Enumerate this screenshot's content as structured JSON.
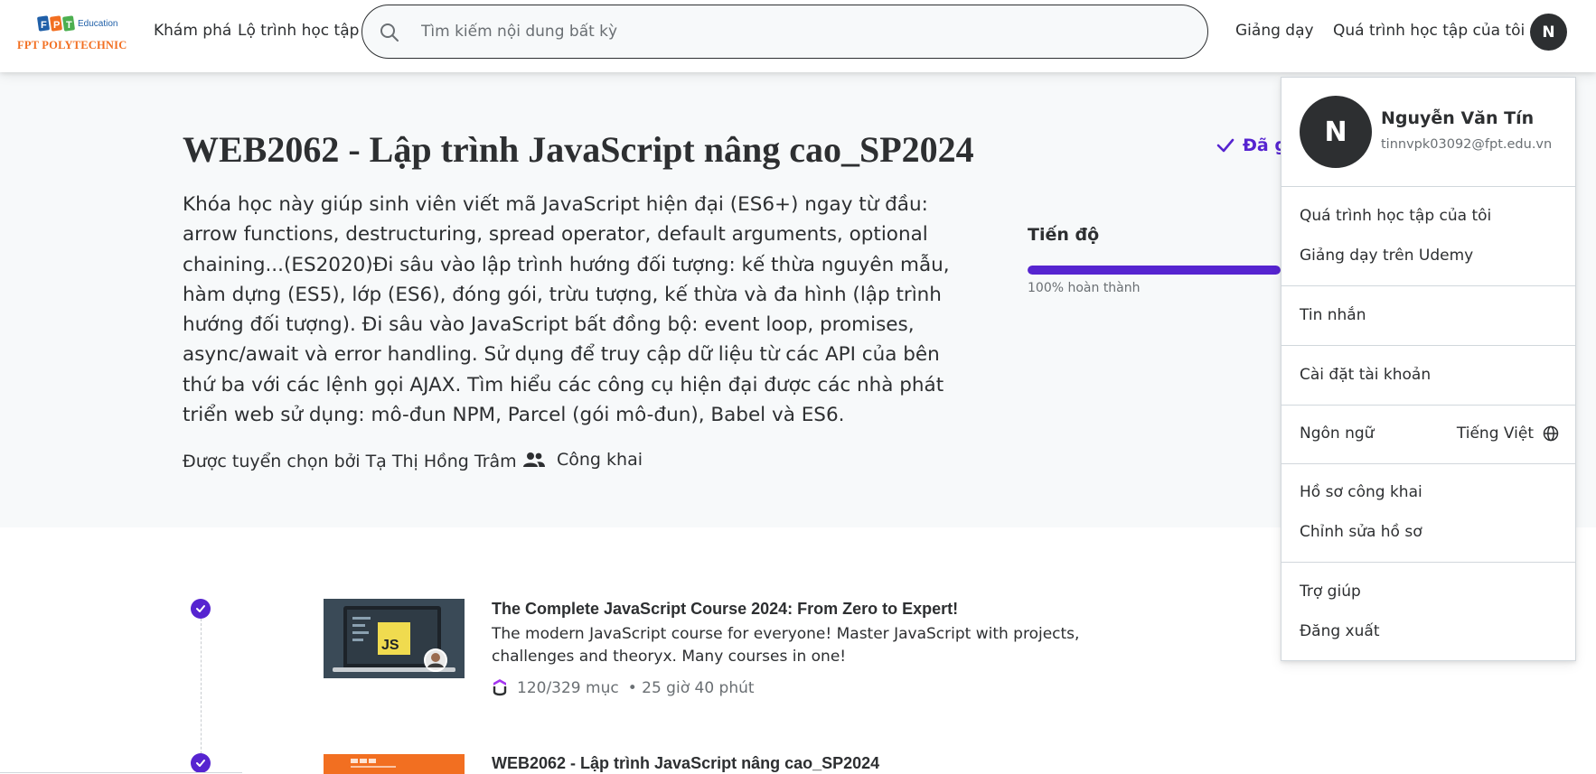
{
  "header": {
    "logo": {
      "brand": "FPT",
      "sub": "Education",
      "name": "FPT POLYTECHNIC"
    },
    "nav": {
      "explore": "Khám phá",
      "learning_path": "Lộ trình học tập"
    },
    "search": {
      "placeholder": "Tìm kiếm nội dung bất kỳ"
    },
    "teach": "Giảng dạy",
    "my_learning": "Quá trình học tập của tôi",
    "avatar_initial": "N"
  },
  "hero": {
    "title": "WEB2062 - Lập trình JavaScript nâng cao_SP2024",
    "description": "Khóa học này giúp sinh viên viết mã JavaScript hiện đại (ES6+) ngay từ đầu: arrow functions, destructuring, spread operator, default arguments, optional chaining...(ES2020)Đi sâu vào lập trình hướng đối tượng: kế thừa nguyên mẫu, hàm dựng (ES5), lớp (ES6), đóng gói, trừu tượng, kế thừa và đa hình (lập trình hướng đối tượng). Đi sâu vào JavaScript bất đồng bộ: event loop, promises, async/await và error handling. Sử dụng để truy cập dữ liệu từ các API của bên thứ ba với các lệnh gọi AJAX. Tìm hiểu các công cụ hiện đại được các nhà phát triển web sử dụng: mô-đun NPM, Parcel (gói mô-đun), Babel và ES6.",
    "curated_by": "Được tuyển chọn bởi Tạ Thị Hồng Trâm",
    "visibility": "Công khai",
    "saved_label": "Đã g",
    "progress": {
      "title": "Tiến độ",
      "percent": 100,
      "label": "100% hoàn thành"
    }
  },
  "courses": [
    {
      "title": "The Complete JavaScript Course 2024: From Zero to Expert!",
      "description": "The modern JavaScript course for everyone! Master JavaScript with projects, challenges and theoryx. Many courses in one!",
      "items": "120/329 mục",
      "duration": "• 25 giờ 40 phút",
      "thumb_badge": "JS"
    },
    {
      "title": "WEB2062 - Lập trình JavaScript nâng cao_SP2024"
    }
  ],
  "dropdown": {
    "initial": "N",
    "name": "Nguyễn Văn Tín",
    "email": "tinnvpk03092@fpt.edu.vn",
    "my_learning": "Quá trình học tập của tôi",
    "teach_on_udemy": "Giảng dạy trên Udemy",
    "messages": "Tin nhắn",
    "account_settings": "Cài đặt tài khoản",
    "language_label": "Ngôn ngữ",
    "language_value": "Tiếng Việt",
    "public_profile": "Hồ sơ công khai",
    "edit_profile": "Chỉnh sửa hồ sơ",
    "help": "Trợ giúp",
    "logout": "Đăng xuất"
  },
  "colors": {
    "accent": "#5624d0",
    "text": "#2d2f31",
    "hero_bg": "#f7f9fa",
    "brand_orange": "#f26f21",
    "brand_blue": "#1f5fa8"
  }
}
